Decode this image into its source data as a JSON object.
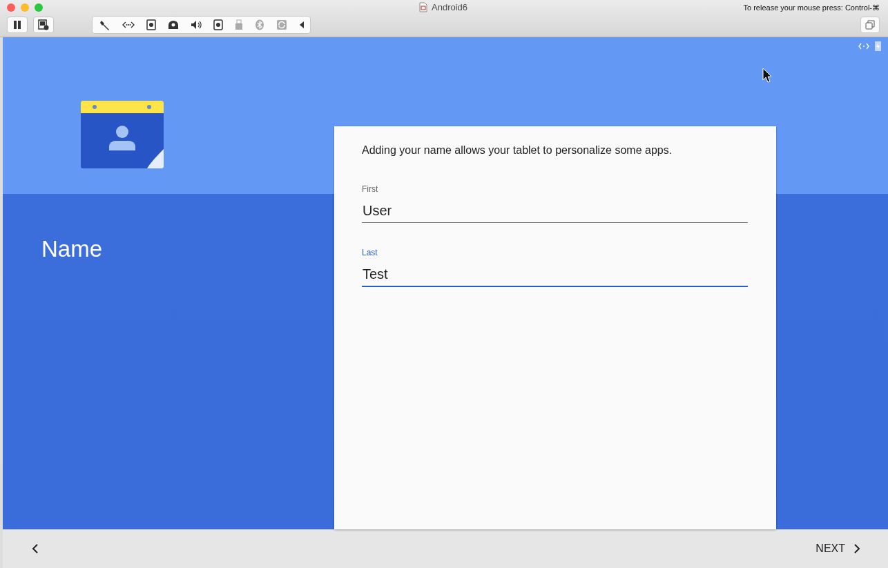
{
  "window": {
    "title": "Android6",
    "release_hint": "To release your mouse press: Control-⌘"
  },
  "setup": {
    "heading": "Name",
    "description": "Adding your name allows your tablet to personalize some apps.",
    "fields": [
      {
        "label": "First",
        "value": "User",
        "focused": false
      },
      {
        "label": "Last",
        "value": "Test",
        "focused": true
      }
    ]
  },
  "nav": {
    "next": "NEXT"
  }
}
